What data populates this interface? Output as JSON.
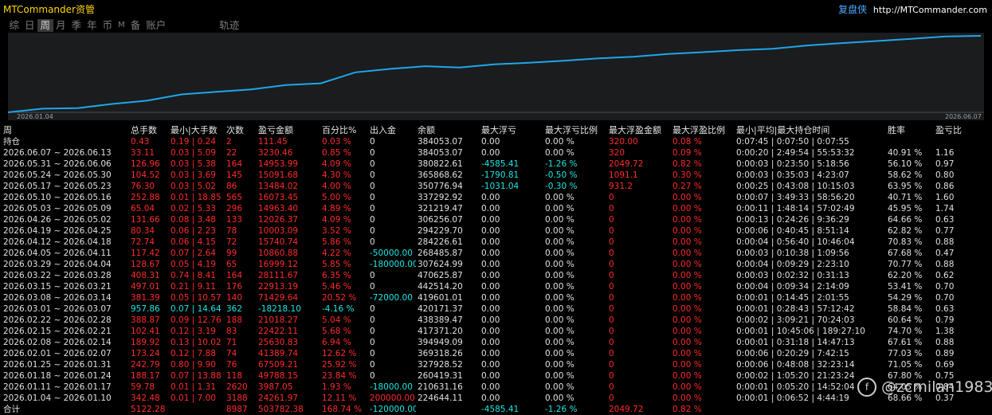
{
  "app_title": "MTCommander资管",
  "brand": {
    "name": "复盘侠",
    "url": "http://MTCommander.com"
  },
  "tabs": [
    {
      "label": "综",
      "active": false
    },
    {
      "label": "日",
      "active": false
    },
    {
      "label": "周",
      "active": true
    },
    {
      "label": "月",
      "active": false
    },
    {
      "label": "季",
      "active": false
    },
    {
      "label": "年",
      "active": false
    },
    {
      "label": "币",
      "active": false
    },
    {
      "label": "M",
      "active": false
    },
    {
      "label": "备",
      "active": false
    },
    {
      "label": "账户",
      "active": false
    },
    {
      "label": "轨迹",
      "active": false
    }
  ],
  "chart_data": {
    "type": "line",
    "x_start_label": "2026.01.04",
    "x_end_label": "2026.06.07",
    "series": [
      {
        "color": "#1fa6e8",
        "values": [
          0,
          24262,
          27250,
          55230,
          76780,
          117993,
          135012,
          151342,
          180009,
          191193,
          263340,
          285829,
          303842,
          294839,
          315838,
          327175,
          340208,
          355948,
          365951,
          384100,
          396119,
          409525,
          418678,
          440071,
          456159,
          469612,
          484566,
          499612,
          503782
        ]
      }
    ],
    "colors": {
      "background": "#1a1c1e",
      "line": "#1fa6e8"
    }
  },
  "table": {
    "headers": [
      "周",
      "总手数",
      "最小|大手数",
      "次数",
      "盈亏金额",
      "百分比%",
      "出入金",
      "余额",
      "最大浮亏",
      "最大浮亏比例",
      "最大浮盈金额",
      "最大浮盈比例",
      "最小|平均|最大持仓时间",
      "胜率",
      "盈亏比"
    ],
    "rows": [
      [
        "持仓",
        "0.43",
        "0.19 | 0.24",
        "2",
        "111.45",
        "0.03 %",
        "0",
        "384053.07",
        "0.00",
        "0.00 %",
        "320.00",
        "0.08 %",
        "0:07:45 | 0:07:50 | 0:07:55",
        "",
        ""
      ],
      [
        "2026.06.07 ~ 2026.06.13",
        "33.11",
        "0.03 | 5.09",
        "22",
        "3230.46",
        "0.85 %",
        "0",
        "384053.07",
        "0.00",
        "0.00 %",
        "320",
        "0.09 %",
        "0:00:20 | 2:49:54 | 55:53:32",
        "40.91 %",
        "1.16"
      ],
      [
        "2026.05.31 ~ 2026.06.06",
        "126.96",
        "0.03 | 5.38",
        "164",
        "14953.99",
        "4.09 %",
        "0",
        "380822.61",
        "-4585.41",
        "-1.26 %",
        "2049.72",
        "0.82 %",
        "0:00:03 | 0:23:50 | 5:18:56",
        "56.10 %",
        "0.97"
      ],
      [
        "2026.05.24 ~ 2026.05.30",
        "104.52",
        "0.03 | 3.69",
        "145",
        "15091.68",
        "4.30 %",
        "0",
        "365868.62",
        "-1790.81",
        "-0.50 %",
        "1091.1",
        "0.30 %",
        "0:00:03 | 0:35:03 | 4:23:07",
        "58.62 %",
        "0.80"
      ],
      [
        "2026.05.17 ~ 2026.05.23",
        "76.30",
        "0.03 | 5.02",
        "86",
        "13484.02",
        "4.00 %",
        "0",
        "350776.94",
        "-1031.04",
        "-0.30 %",
        "931.2",
        "0.27 %",
        "0:00:25 | 0:43:08 | 10:15:03",
        "63.95 %",
        "0.86"
      ],
      [
        "2026.05.10 ~ 2026.05.16",
        "252.88",
        "0.01 | 18.85",
        "565",
        "16073.45",
        "5.00 %",
        "0",
        "337292.92",
        "0.00",
        "0.00 %",
        "0",
        "0.00 %",
        "0:00:07 | 3:49:33 | 58:56:20",
        "40.71 %",
        "1.60"
      ],
      [
        "2026.05.03 ~ 2026.05.09",
        "65.04",
        "0.02 | 5.33",
        "296",
        "14963.40",
        "4.89 %",
        "0",
        "321219.47",
        "0.00",
        "0.00 %",
        "0",
        "0.00 %",
        "0:00:11 | 1:48:14 | 57:02:49",
        "45.95 %",
        "1.74"
      ],
      [
        "2026.04.26 ~ 2026.05.02",
        "131.66",
        "0.08 | 3.48",
        "133",
        "12026.37",
        "4.09 %",
        "0",
        "306256.07",
        "0.00",
        "0.00 %",
        "0",
        "0.00 %",
        "0:00:13 | 0:24:26 | 9:36:29",
        "64.66 %",
        "0.63"
      ],
      [
        "2026.04.19 ~ 2026.04.25",
        "80.34",
        "0.06 | 2.23",
        "78",
        "10003.09",
        "3.52 %",
        "0",
        "294229.70",
        "0.00",
        "0.00 %",
        "0",
        "0.00 %",
        "0:00:06 | 0:40:45 | 8:51:14",
        "62.82 %",
        "0.77"
      ],
      [
        "2026.04.12 ~ 2026.04.18",
        "72.74",
        "0.06 | 4.15",
        "72",
        "15740.74",
        "5.86 %",
        "0",
        "284226.61",
        "0.00",
        "0.00 %",
        "0",
        "0.00 %",
        "0:00:04 | 0:56:40 | 10:46:04",
        "70.83 %",
        "0.88"
      ],
      [
        "2026.04.05 ~ 2026.04.11",
        "117.42",
        "0.07 | 2.64",
        "99",
        "10860.88",
        "4.22 %",
        "-50000.00",
        "268485.87",
        "0.00",
        "0.00 %",
        "0",
        "0.00 %",
        "0:00:03 | 0:10:38 | 1:09:56",
        "67.68 %",
        "0.47"
      ],
      [
        "2026.03.29 ~ 2026.04.04",
        "128.67",
        "0.05 | 4.19",
        "65",
        "16999.12",
        "5.85 %",
        "-180000.00",
        "307624.99",
        "0.00",
        "0.00 %",
        "0",
        "0.00 %",
        "0:00:04 | 0:09:29 | 2:23:10",
        "70.77 %",
        "0.88"
      ],
      [
        "2026.03.22 ~ 2026.03.28",
        "408.31",
        "0.74 | 8.41",
        "164",
        "28111.67",
        "6.35 %",
        "0",
        "470625.87",
        "0.00",
        "0.00 %",
        "0",
        "0.00 %",
        "0:00:03 | 0:02:32 | 0:31:13",
        "62.20 %",
        "0.62"
      ],
      [
        "2026.03.15 ~ 2026.03.21",
        "497.01",
        "0.21 | 9.11",
        "176",
        "22913.19",
        "5.46 %",
        "0",
        "442514.20",
        "0.00",
        "0.00 %",
        "0",
        "0.00 %",
        "0:00:04 | 0:09:34 | 2:14:09",
        "53.41 %",
        "0.70"
      ],
      [
        "2026.03.08 ~ 2026.03.14",
        "381.39",
        "0.05 | 10.57",
        "140",
        "71429.64",
        "20.52 %",
        "-72000.00",
        "419601.01",
        "0.00",
        "0.00 %",
        "0",
        "0.00 %",
        "0:00:01 | 0:14:45 | 2:01:55",
        "54.29 %",
        "0.70"
      ],
      [
        "2026.03.01 ~ 2026.03.07",
        "957.86",
        "0.07 | 14.64",
        "362",
        "-18218.10",
        "-4.16 %",
        "0",
        "420171.37",
        "0.00",
        "0.00 %",
        "0",
        "0.00 %",
        "0:00:01 | 0:28:43 | 57:12:42",
        "58.84 %",
        "0.63"
      ],
      [
        "2026.02.22 ~ 2026.02.28",
        "388.87",
        "0.09 | 12.76",
        "188",
        "21018.27",
        "5.04 %",
        "0",
        "438389.47",
        "0.00",
        "0.00 %",
        "0",
        "0.00 %",
        "0:00:02 | 3:09:21 | 70:24:03",
        "60.64 %",
        "0.79"
      ],
      [
        "2026.02.15 ~ 2026.02.21",
        "102.41",
        "0.12 | 3.19",
        "83",
        "22422.11",
        "5.68 %",
        "0",
        "417371.20",
        "0.00",
        "0.00 %",
        "0",
        "0.00 %",
        "0:00:01 | 10:45:06 | 189:27:10",
        "74.70 %",
        "1.38"
      ],
      [
        "2026.02.08 ~ 2026.02.14",
        "189.92",
        "0.13 | 10.02",
        "71",
        "25630.83",
        "6.94 %",
        "0",
        "394949.09",
        "0.00",
        "0.00 %",
        "0",
        "0.00 %",
        "0:00:01 | 0:31:18 | 14:47:13",
        "67.61 %",
        "0.88"
      ],
      [
        "2026.02.01 ~ 2026.02.07",
        "173.24",
        "0.12 | 7.88",
        "74",
        "41389.74",
        "12.62 %",
        "0",
        "369318.26",
        "0.00",
        "0.00 %",
        "0",
        "0.00 %",
        "0:00:06 | 0:20:29 | 7:42:15",
        "77.03 %",
        "0.89"
      ],
      [
        "2026.01.25 ~ 2026.01.31",
        "242.79",
        "0.80 | 9.90",
        "76",
        "67509.21",
        "25.92 %",
        "0",
        "327928.52",
        "0.00",
        "0.00 %",
        "0",
        "0.00 %",
        "0:00:06 | 0:48:08 | 32:23:14",
        "71.05 %",
        "0.69"
      ],
      [
        "2026.01.18 ~ 2026.01.24",
        "188.17",
        "0.07 | 13.88",
        "118",
        "49788.15",
        "23.84 %",
        "0",
        "260419.31",
        "0.00",
        "0.00 %",
        "0",
        "0.00 %",
        "0:00:02 | 1:05:20 | 21:23:24",
        "67.80 %",
        "0.75"
      ],
      [
        "2026.01.11 ~ 2026.01.17",
        "59.78",
        "0.01 | 1.31",
        "2620",
        "3987.05",
        "1.93 %",
        "-18000.00",
        "210631.16",
        "0.00",
        "0.00 %",
        "0",
        "0.00 %",
        "0:00:01 | 0:05:20 | 14:52:04",
        "64.05 %",
        "0.84"
      ],
      [
        "2026.01.04 ~ 2026.01.10",
        "342.48",
        "0.01 | 7.00",
        "3188",
        "24261.97",
        "12.11 %",
        "200000.00",
        "224644.11",
        "0.00",
        "0.00 %",
        "0",
        "0.00 %",
        "0:00:01 | 0:06:52 | 4:44:19",
        "68.66 %",
        "0.37"
      ],
      [
        "合计",
        "5122.28",
        "",
        "8987",
        "503782.38",
        "168.74 %",
        "-120000.00",
        "",
        "-4585.41",
        "-1.26 %",
        "2049.72",
        "0.82 %",
        "",
        "",
        ""
      ]
    ]
  },
  "watermark": {
    "text": "@zcmilan1983",
    "icon": "facebook-style-icon"
  }
}
